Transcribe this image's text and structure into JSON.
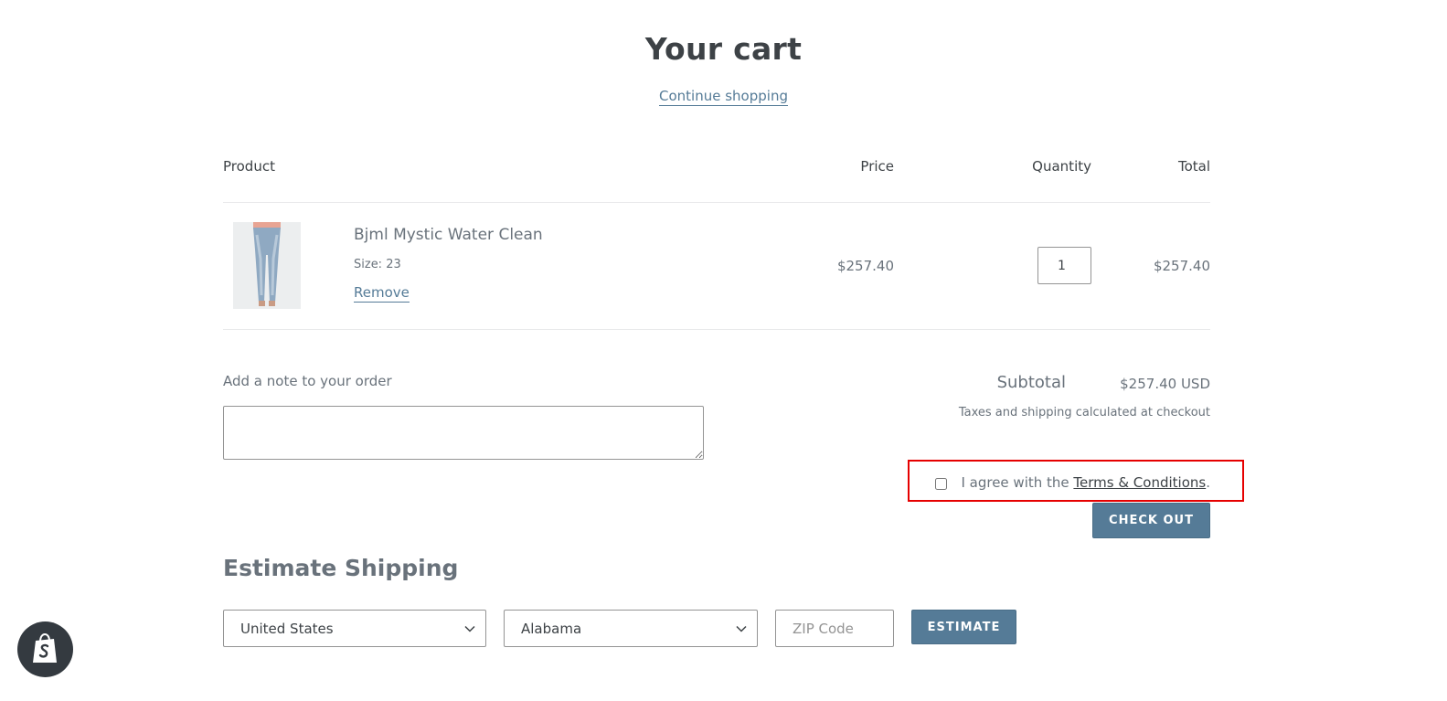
{
  "page": {
    "title": "Your cart",
    "continue_label": "Continue shopping"
  },
  "table": {
    "headers": {
      "product": "Product",
      "price": "Price",
      "quantity": "Quantity",
      "total": "Total"
    },
    "items": [
      {
        "title": "Bjml Mystic Water Clean",
        "variant": "Size: 23",
        "remove_label": "Remove",
        "price": "$257.40",
        "quantity": "1",
        "total": "$257.40"
      }
    ]
  },
  "note": {
    "label": "Add a note to your order",
    "value": ""
  },
  "summary": {
    "subtotal_label": "Subtotal",
    "subtotal_value": "$257.40 USD",
    "tax_note": "Taxes and shipping calculated at checkout",
    "terms_prefix": "I agree with the ",
    "terms_link": "Terms & Conditions",
    "terms_suffix": ".",
    "terms_checked": false,
    "checkout_label": "CHECK OUT"
  },
  "shipping": {
    "heading": "Estimate Shipping",
    "country": "United States",
    "province": "Alabama",
    "zip_placeholder": "ZIP Code",
    "estimate_label": "ESTIMATE"
  },
  "colors": {
    "accent": "#557b97",
    "text": "#3d4246",
    "muted": "#69727b",
    "highlight": "#e60000"
  },
  "icons": {
    "select_arrow": "chevron-down-icon",
    "badge": "shopify-bag-icon"
  }
}
